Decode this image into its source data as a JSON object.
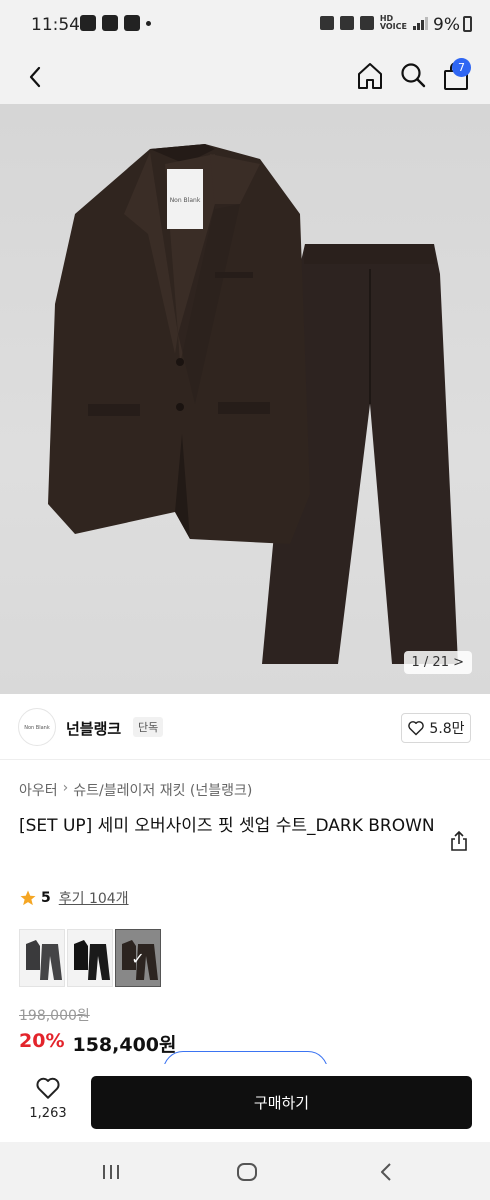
{
  "status_bar": {
    "time": "11:54",
    "battery": "9%"
  },
  "nav": {
    "cart_count": "7"
  },
  "hero": {
    "image_counter": "1 / 21 >",
    "jacket_label": "Non Blank"
  },
  "brand": {
    "logo_text": "Non Blank",
    "name": "넌블랭크",
    "badge": "단독",
    "likes": "5.8만"
  },
  "breadcrumb": {
    "items": [
      "아우터",
      "슈트/블레이저 재킷 (넌블랭크)"
    ]
  },
  "product": {
    "title": "[SET UP] 세미 오버사이즈 핏 셋업 수트_DARK BROWN",
    "rating": "5",
    "reviews": "후기 104개",
    "original_price": "198,000원",
    "discount": "20%",
    "sale_price": "158,400원"
  },
  "colors": [
    {
      "name": "charcoal",
      "hex": "#3a3a3c",
      "selected": false
    },
    {
      "name": "black",
      "hex": "#141414",
      "selected": false
    },
    {
      "name": "dark-brown",
      "hex": "#2c2420",
      "selected": true
    }
  ],
  "bottom_bar": {
    "wishlist_count": "1,263",
    "buy_label": "구매하기"
  },
  "theme": {
    "accent": "#2f66f3",
    "discount_color": "#e3242b",
    "buy_button_color": "#0f0f0f"
  }
}
